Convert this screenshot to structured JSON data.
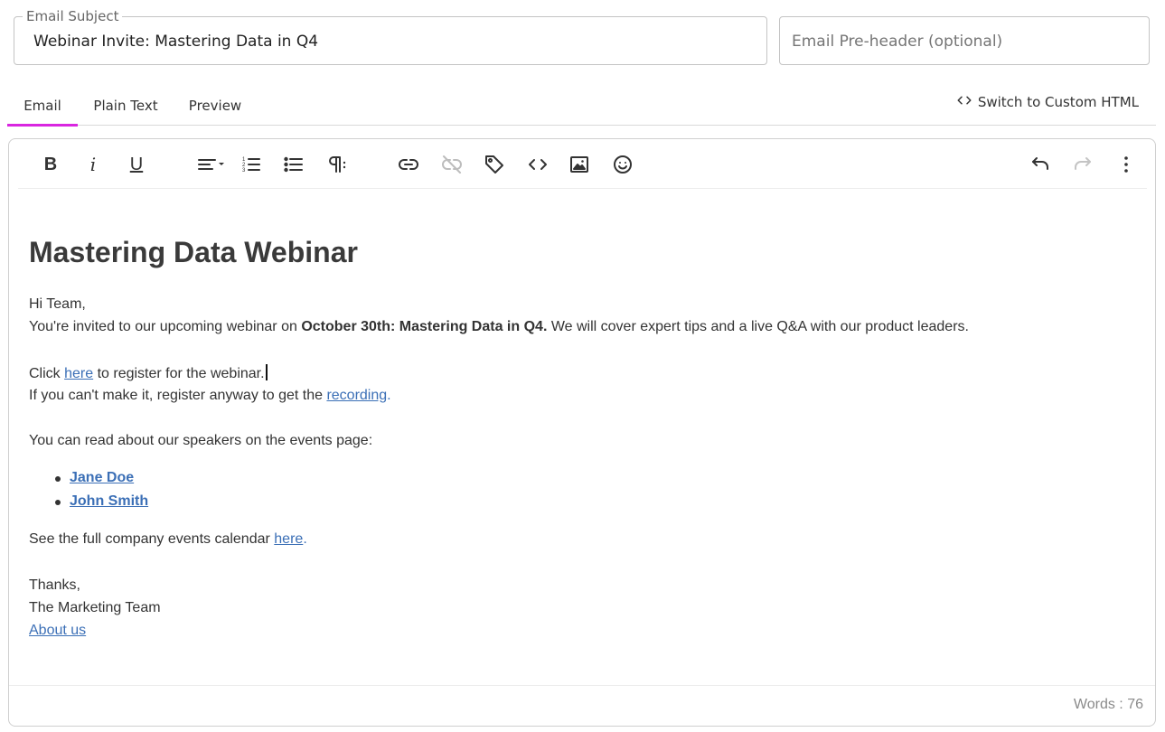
{
  "subject": {
    "legend": "Email Subject",
    "value": "Webinar Invite: Mastering Data in Q4"
  },
  "preheader": {
    "placeholder": "Email Pre-header (optional)"
  },
  "tabs": [
    {
      "label": "Email",
      "active": true
    },
    {
      "label": "Plain Text",
      "active": false
    },
    {
      "label": "Preview",
      "active": false
    }
  ],
  "switch_html": {
    "label": "Switch to Custom HTML",
    "icon": "code-icon"
  },
  "toolbar": {
    "bold": "B",
    "italic": "i",
    "underline": "U",
    "icons": [
      "bold-icon",
      "italic-icon",
      "underline-icon",
      "align-icon",
      "ordered-list-icon",
      "bulleted-list-icon",
      "paragraph-icon",
      "link-icon",
      "unlink-icon",
      "tag-icon",
      "code-icon",
      "image-icon",
      "emoji-icon",
      "undo-icon",
      "redo-icon",
      "more-vertical-icon"
    ]
  },
  "content": {
    "heading": "Mastering Data Webinar",
    "greeting": "Hi Team,",
    "invite_prefix": "You're invited to our upcoming webinar on ",
    "invite_bold": "October 30th: Mastering Data in Q4.",
    "invite_suffix": " We will cover expert tips and a live Q&A with our product leaders.",
    "click_prefix": "Click ",
    "click_link": "here",
    "click_suffix": " to register for the webinar.",
    "cant_prefix": "If you can't make it, register anyway to get the ",
    "cant_link": "recording",
    "cant_suffix": ".",
    "speakers_intro": "You can read about our speakers on the events page:",
    "speakers": [
      "Jane Doe",
      "John Smith"
    ],
    "calendar_prefix": "See the full company events calendar ",
    "calendar_link": "here",
    "calendar_suffix": ".",
    "thanks": "Thanks,",
    "signature": "The Marketing Team",
    "about_link": "About us"
  },
  "footer": {
    "word_count": "Words : 76"
  },
  "colors": {
    "accent": "#d926e0",
    "link": "#3b6fb6",
    "text": "#333333"
  }
}
